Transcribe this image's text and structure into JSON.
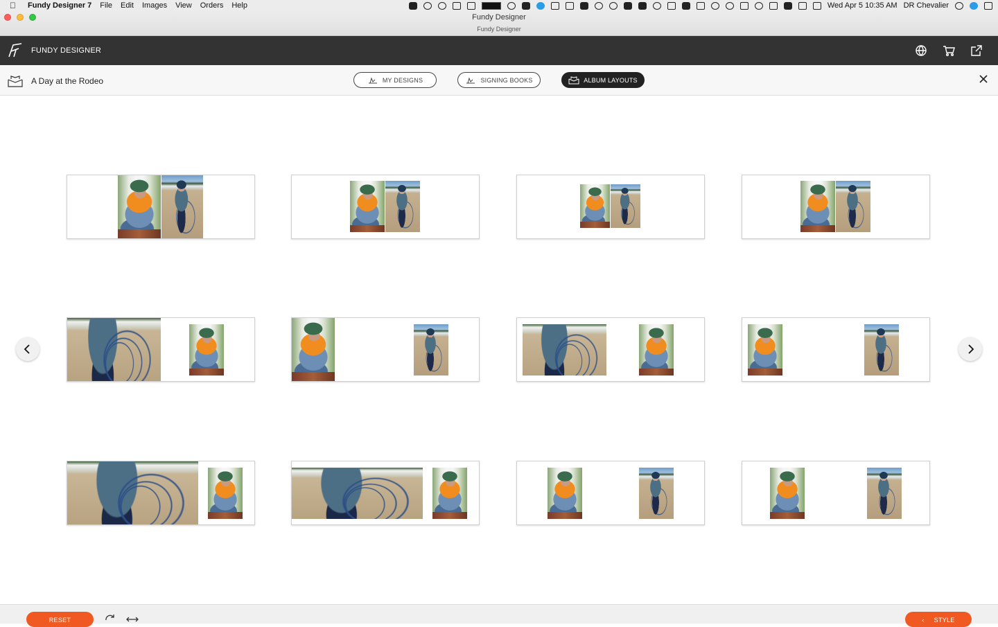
{
  "menubar": {
    "apple_glyph": "",
    "app_name": "Fundy Designer 7",
    "menus": [
      "File",
      "Edit",
      "Images",
      "View",
      "Orders",
      "Help"
    ],
    "datetime": "Wed Apr 5  10:35 AM",
    "user": "DR Chevalier"
  },
  "window": {
    "title": "Fundy Designer",
    "subtitle": "Fundy Designer"
  },
  "header": {
    "brand": "FUNDY DESIGNER",
    "icons": [
      "help-globe-icon",
      "cart-icon",
      "export-icon"
    ]
  },
  "project": {
    "title": "A Day at the Rodeo",
    "tabs": [
      {
        "label": "MY DESIGNS",
        "active": false,
        "icon": "hand-icon"
      },
      {
        "label": "SIGNING BOOKS",
        "active": false,
        "icon": "hand-icon"
      },
      {
        "label": "ALBUM LAYOUTS",
        "active": true,
        "icon": "album-icon"
      }
    ]
  },
  "layouts": [
    {
      "id": 1,
      "photos": [
        "cowboy",
        "roper"
      ]
    },
    {
      "id": 2,
      "photos": [
        "cowboy",
        "roper"
      ]
    },
    {
      "id": 3,
      "photos": [
        "cowboy",
        "roper"
      ]
    },
    {
      "id": 4,
      "photos": [
        "cowboy",
        "roper"
      ]
    },
    {
      "id": 5,
      "photos": [
        "rope",
        "cowboy"
      ]
    },
    {
      "id": 6,
      "photos": [
        "cowboy",
        "roper"
      ]
    },
    {
      "id": 7,
      "photos": [
        "rope",
        "cowboy"
      ]
    },
    {
      "id": 8,
      "photos": [
        "cowboy",
        "roper"
      ]
    },
    {
      "id": 9,
      "photos": [
        "rope",
        "cowboy"
      ]
    },
    {
      "id": 10,
      "photos": [
        "rope",
        "cowboy"
      ]
    },
    {
      "id": 11,
      "photos": [
        "cowboy",
        "roper"
      ]
    },
    {
      "id": 12,
      "photos": [
        "cowboy",
        "roper"
      ]
    }
  ],
  "footer": {
    "reset_label": "RESET",
    "style_label": "STYLE",
    "style_glyph": "‹"
  },
  "colors": {
    "header_bg": "#333333",
    "accent_orange": "#f05a22",
    "active_tab": "#222222"
  }
}
